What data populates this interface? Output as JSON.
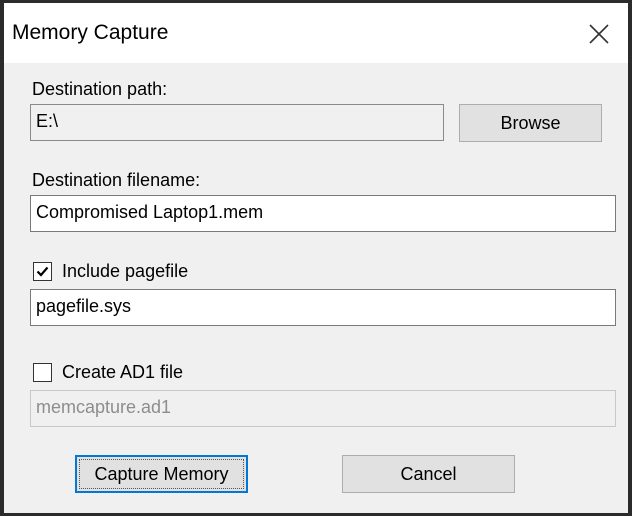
{
  "window": {
    "title": "Memory Capture"
  },
  "destination_path": {
    "label": "Destination path:",
    "value": "E:\\",
    "browse_label": "Browse"
  },
  "destination_filename": {
    "label": "Destination filename:",
    "value": "Compromised Laptop1.mem"
  },
  "pagefile": {
    "checkbox_label": "Include pagefile",
    "checked": true,
    "value": "pagefile.sys"
  },
  "ad1": {
    "checkbox_label": "Create AD1 file",
    "checked": false,
    "value": "memcapture.ad1"
  },
  "actions": {
    "capture_label": "Capture Memory",
    "cancel_label": "Cancel"
  },
  "icons": {
    "close": "close-icon",
    "checkmark": "checkmark-icon"
  },
  "colors": {
    "dialog_bg": "#f0f0f0",
    "titlebar_bg": "#ffffff",
    "default_button_border": "#0078d7",
    "disabled_text": "#8d8d8d"
  }
}
